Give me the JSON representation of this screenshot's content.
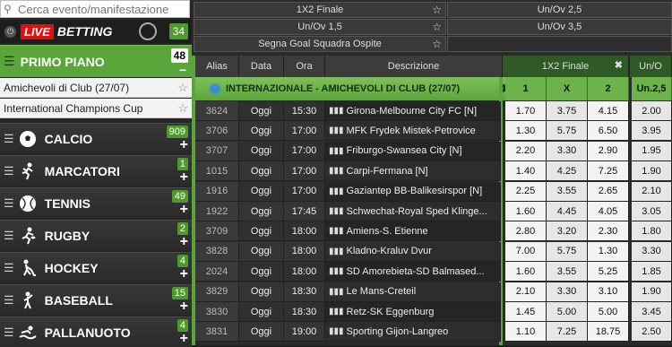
{
  "search": {
    "placeholder": "Cerca evento/manifestazione"
  },
  "live": {
    "tag": "LIVE",
    "label": "BETTING",
    "count": "34"
  },
  "primo": {
    "label": "PRIMO PIANO",
    "count": "48",
    "minus": "−"
  },
  "subitems": [
    {
      "label": "Amichevoli di Club (27/07)"
    },
    {
      "label": "International Champions Cup"
    }
  ],
  "sports": [
    {
      "label": "CALCIO",
      "count": "909",
      "icon": "soccer-ball-icon"
    },
    {
      "label": "MARCATORI",
      "count": "1",
      "icon": "runner-icon"
    },
    {
      "label": "TENNIS",
      "count": "49",
      "icon": "tennis-ball-icon"
    },
    {
      "label": "RUGBY",
      "count": "2",
      "icon": "rugby-player-icon"
    },
    {
      "label": "HOCKEY",
      "count": "4",
      "icon": "hockey-player-icon"
    },
    {
      "label": "BASEBALL",
      "count": "15",
      "icon": "baseball-player-icon"
    },
    {
      "label": "PALLANUOTO",
      "count": "4",
      "icon": "swimmer-icon"
    }
  ],
  "filters": {
    "f1": "1X2 Finale",
    "f2": "Un/Ov 2,5",
    "f3": "Un/Ov 1,5",
    "f4": "Un/Ov 3,5",
    "f5": "Segna Goal Squadra Ospite"
  },
  "headers": {
    "alias": "Alias",
    "data": "Data",
    "ora": "Ora",
    "desc": "Descrizione",
    "market1": "1X2 Finale",
    "market2": "Un/O",
    "x": "✖"
  },
  "competition": {
    "name": "INTERNAZIONALE - AMICHEVOLI DI CLUB (27/07)",
    "col1": "1",
    "colx": "X",
    "col2": "2",
    "colov": "Un.2,5"
  },
  "rows": [
    {
      "alias": "3624",
      "data": "Oggi",
      "ora": "15:30",
      "desc": "Girona-Melbourne City FC [N]",
      "o1": "1.70",
      "ox": "3.75",
      "o2": "4.15",
      "ov": "2.00"
    },
    {
      "alias": "3706",
      "data": "Oggi",
      "ora": "17:00",
      "desc": "MFK Frydek Mistek-Petrovice",
      "o1": "1.30",
      "ox": "5.75",
      "o2": "6.50",
      "ov": "3.95"
    },
    {
      "alias": "3707",
      "data": "Oggi",
      "ora": "17:00",
      "desc": "Friburgo-Swansea City [N]",
      "o1": "2.20",
      "ox": "3.30",
      "o2": "2.90",
      "ov": "1.95"
    },
    {
      "alias": "1015",
      "data": "Oggi",
      "ora": "17:00",
      "desc": "Carpi-Fermana [N]",
      "o1": "1.40",
      "ox": "4.25",
      "o2": "7.25",
      "ov": "1.90"
    },
    {
      "alias": "1916",
      "data": "Oggi",
      "ora": "17:00",
      "desc": "Gaziantep BB-Balikesirspor [N]",
      "o1": "2.25",
      "ox": "3.55",
      "o2": "2.65",
      "ov": "2.10"
    },
    {
      "alias": "1922",
      "data": "Oggi",
      "ora": "17:45",
      "desc": "Schwechat-Royal Sped Klinge...",
      "o1": "1.60",
      "ox": "4.45",
      "o2": "4.05",
      "ov": "3.05"
    },
    {
      "alias": "3709",
      "data": "Oggi",
      "ora": "18:00",
      "desc": "Amiens-S. Etienne",
      "o1": "2.80",
      "ox": "3.20",
      "o2": "2.30",
      "ov": "1.80"
    },
    {
      "alias": "3828",
      "data": "Oggi",
      "ora": "18:00",
      "desc": "Kladno-Kraluv Dvur",
      "o1": "7.00",
      "ox": "5.75",
      "o2": "1.30",
      "ov": "3.30"
    },
    {
      "alias": "2024",
      "data": "Oggi",
      "ora": "18:00",
      "desc": "SD Amorebieta-SD Balmased...",
      "o1": "1.60",
      "ox": "3.55",
      "o2": "5.25",
      "ov": "1.85"
    },
    {
      "alias": "3829",
      "data": "Oggi",
      "ora": "18:30",
      "desc": "Le Mans-Creteil",
      "o1": "2.10",
      "ox": "3.30",
      "o2": "3.10",
      "ov": "1.90"
    },
    {
      "alias": "3830",
      "data": "Oggi",
      "ora": "18:30",
      "desc": "Retz-SK Eggenburg",
      "o1": "1.45",
      "ox": "5.00",
      "o2": "5.00",
      "ov": "3.45"
    },
    {
      "alias": "3831",
      "data": "Oggi",
      "ora": "19:00",
      "desc": "Sporting Gijon-Langreo",
      "o1": "1.10",
      "ox": "7.25",
      "o2": "18.75",
      "ov": "2.50"
    }
  ]
}
